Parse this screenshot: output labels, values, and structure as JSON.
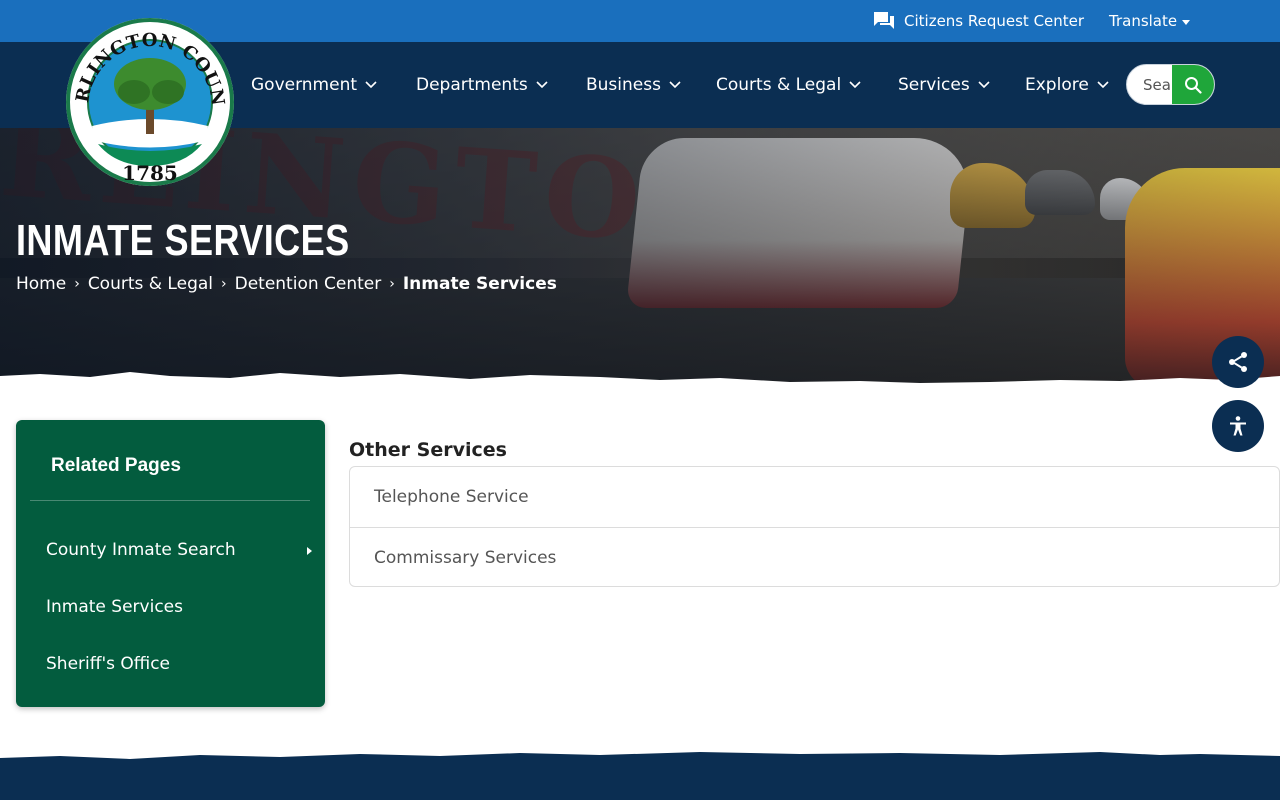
{
  "topbar": {
    "citizens_request": "Citizens Request Center",
    "translate": "Translate"
  },
  "logo": {
    "top_text": "DARLINGTON COUNTY",
    "year": "1785"
  },
  "nav": {
    "items": [
      "Government",
      "Departments",
      "Business",
      "Courts & Legal",
      "Services",
      "Explore"
    ],
    "search_placeholder": "Search"
  },
  "hero": {
    "title": "INMATE SERVICES",
    "breadcrumbs": [
      "Home",
      "Courts & Legal",
      "Detention Center",
      "Inmate Services"
    ]
  },
  "sidebar": {
    "title": "Related Pages",
    "items": [
      "County Inmate Search",
      "Inmate Services",
      "Sheriff's Office"
    ]
  },
  "main": {
    "section_title": "Other Services",
    "links": [
      "Telephone Service",
      "Commissary Services"
    ]
  },
  "colors": {
    "topbar": "#1a6fbd",
    "navbar": "#0b2e52",
    "sidebar": "#035c3e",
    "search_button": "#1fa63a"
  }
}
